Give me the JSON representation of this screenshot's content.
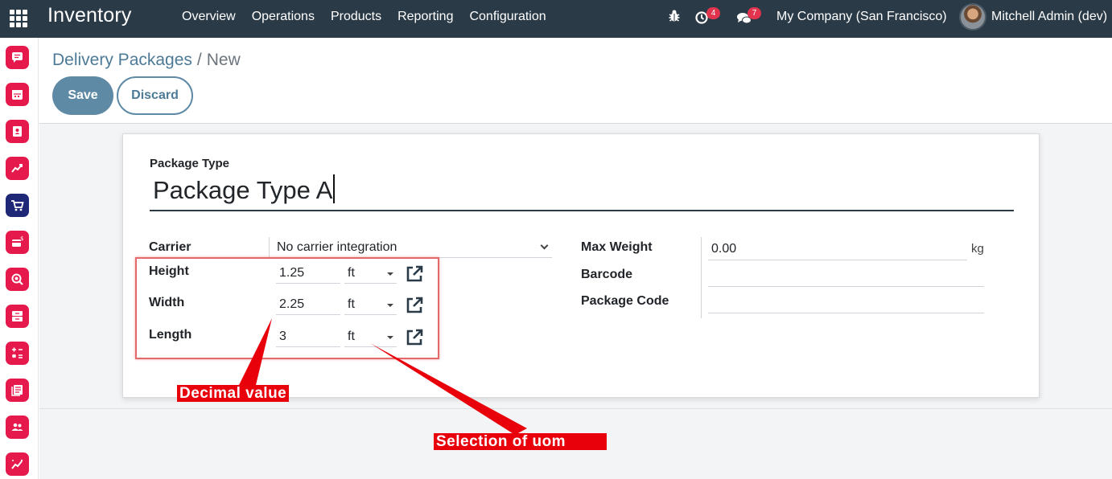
{
  "navbar": {
    "app_name": "Inventory",
    "menu": [
      "Overview",
      "Operations",
      "Products",
      "Reporting",
      "Configuration"
    ],
    "activity_count": "4",
    "message_count": "7",
    "company": "My Company (San Francisco)",
    "user": "Mitchell Admin (dev)"
  },
  "sidebar": {
    "apps": [
      "discuss",
      "calendar",
      "contacts",
      "crm",
      "sales",
      "invoicing",
      "search",
      "inventory",
      "accounting",
      "documents",
      "employees",
      "dashboards"
    ]
  },
  "breadcrumb": {
    "parent": "Delivery Packages",
    "separator": "/",
    "current": "New"
  },
  "buttons": {
    "save": "Save",
    "discard": "Discard"
  },
  "form": {
    "package_type_label": "Package Type",
    "package_type_value": "Package Type A",
    "carrier_label": "Carrier",
    "carrier_value": "No carrier integration",
    "height_label": "Height",
    "height_value": "1.25",
    "height_uom": "ft",
    "width_label": "Width",
    "width_value": "2.25",
    "width_uom": "ft",
    "length_label": "Length",
    "length_value": "3",
    "length_uom": "ft",
    "max_weight_label": "Max Weight",
    "max_weight_value": "0.00",
    "max_weight_unit": "kg",
    "barcode_label": "Barcode",
    "barcode_value": "",
    "package_code_label": "Package Code",
    "package_code_value": ""
  },
  "annotations": {
    "decimal_value": "Decimal value",
    "selection_of_uom": "Selection of uom"
  },
  "colors": {
    "navbar": "#2b3a47",
    "primary_button": "#5f8aa6",
    "sidebar_icon": "#e5194b",
    "annotation": "#e8000b"
  }
}
